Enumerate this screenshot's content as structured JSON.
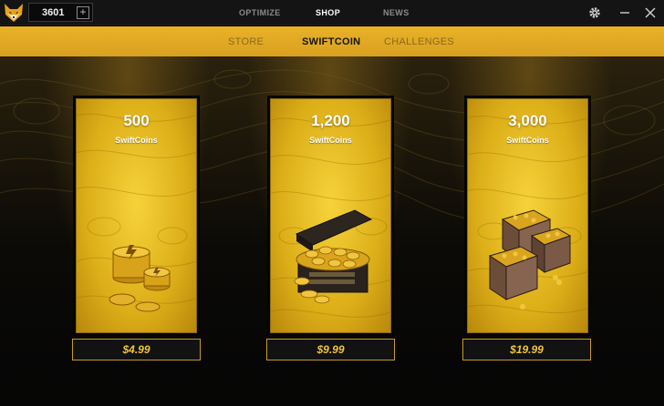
{
  "header": {
    "coin_balance": "3601",
    "add_label": "+",
    "nav": [
      "OPTIMIZE",
      "SHOP",
      "NEWS"
    ],
    "nav_active": "SHOP",
    "icons": [
      "fox-logo-icon",
      "plus-icon",
      "gear-icon",
      "minimize-icon",
      "close-icon"
    ]
  },
  "subnav": {
    "tabs": [
      "STORE",
      "SWIFTCOIN",
      "CHALLENGES"
    ],
    "active": "SWIFTCOIN"
  },
  "cards": [
    {
      "amount": "500",
      "unit": "SwiftCoins",
      "price": "$4.99",
      "art": "coin-stack-icon"
    },
    {
      "amount": "1,200",
      "unit": "SwiftCoins",
      "price": "$9.99",
      "art": "treasure-chest-icon"
    },
    {
      "amount": "3,000",
      "unit": "SwiftCoins",
      "price": "$19.99",
      "art": "coin-crates-icon"
    }
  ],
  "colors": {
    "gold": "#e9b227",
    "price_text": "#efc63a",
    "titlebar": "#141414"
  }
}
